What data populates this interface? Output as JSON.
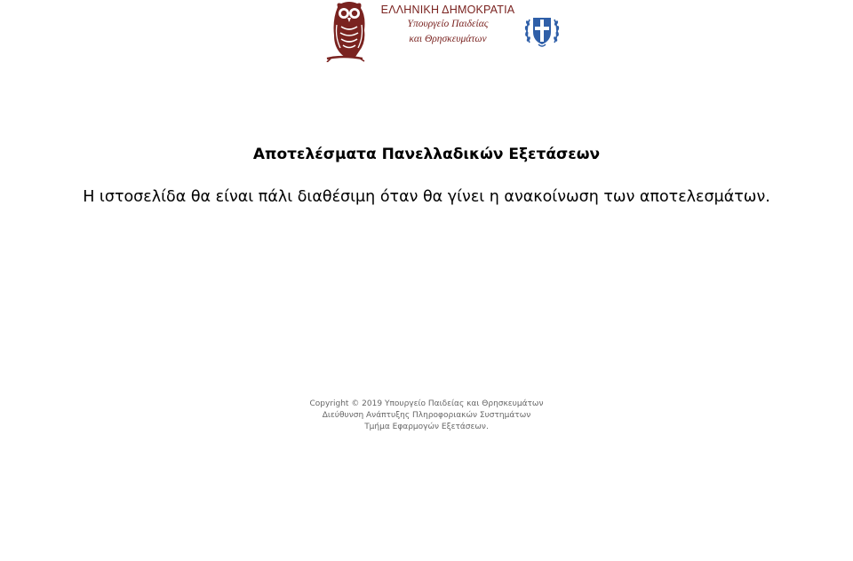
{
  "header": {
    "ministry_title": "ΕΛΛΗΝΙΚΗ ΔΗΜΟΚΡΑΤΙΑ",
    "ministry_line1": "Υπουργείο Παιδείας",
    "ministry_line2": "και Θρησκευμάτων",
    "logo_icon": "owl-logo-icon",
    "emblem_icon": "greek-coat-of-arms-icon",
    "brand_color": "#7a2320",
    "emblem_color": "#2f5fa8"
  },
  "main": {
    "title": "Αποτελέσματα Πανελλαδικών Εξετάσεων",
    "message": "Η ιστοσελίδα θα είναι πάλι διαθέσιμη όταν θα γίνει η ανακοίνωση των αποτελεσμάτων."
  },
  "footer": {
    "line1": "Copyright © 2019 Υπουργείο Παιδείας και Θρησκευμάτων",
    "line2": "Διεύθυνση Ανάπτυξης Πληροφοριακών Συστημάτων",
    "line3": "Τμήμα Εφαρμογών Εξετάσεων.",
    "text_color": "#666666"
  }
}
